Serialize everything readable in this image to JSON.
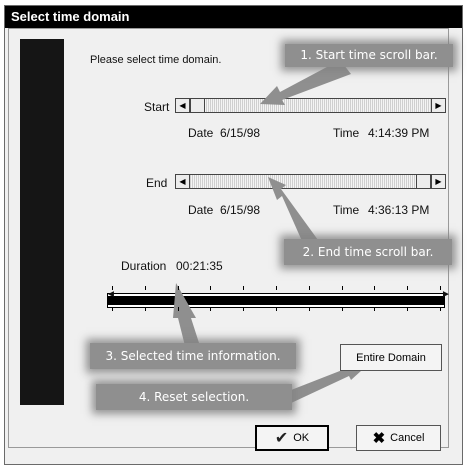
{
  "window": {
    "title": "Select time domain"
  },
  "instructions": "Please select time domain.",
  "start": {
    "label": "Start",
    "date_label": "Date",
    "date": "6/15/98",
    "time_label": "Time",
    "time": "4:14:39 PM",
    "thumb_fraction": 0.0
  },
  "end": {
    "label": "End",
    "date_label": "Date",
    "date": "6/15/98",
    "time_label": "Time",
    "time": "4:36:13 PM",
    "thumb_fraction": 1.0
  },
  "duration": {
    "label": "Duration",
    "value": "00:21:35"
  },
  "buttons": {
    "entire_domain": "Entire Domain",
    "ok": "OK",
    "cancel": "Cancel"
  },
  "icons": {
    "ok": "checkmark-icon",
    "cancel": "x-icon",
    "left": "arrow-left-icon",
    "right": "arrow-right-icon"
  },
  "callouts": {
    "c1": "1. Start time scroll bar.",
    "c2": "2. End time scroll bar.",
    "c3": "3. Selected time information.",
    "c4": "4.  Reset selection."
  },
  "colors": {
    "titlebar": "#000000",
    "callout": "#8f8f8f",
    "background": "#f0f0f0"
  }
}
